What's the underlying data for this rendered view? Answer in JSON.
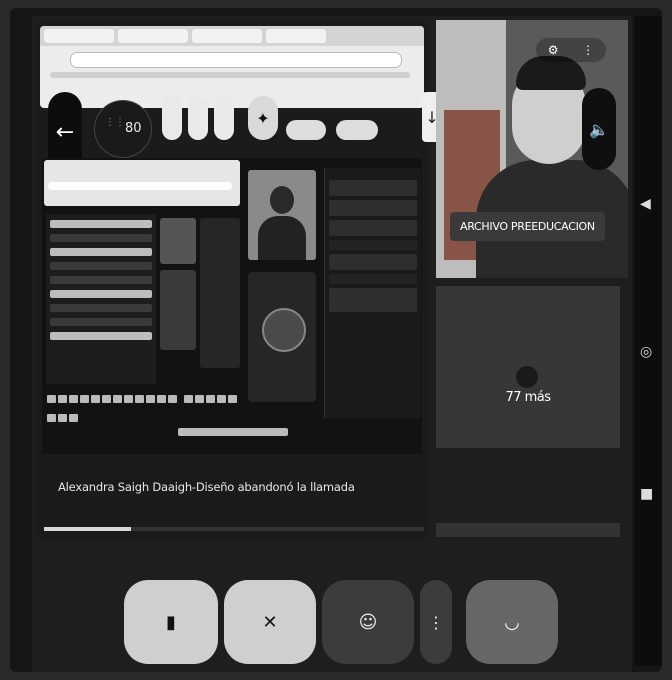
{
  "presentation": {
    "participants_count": "80",
    "notification": "Alexandra Saigh Daaigh-Diseño abandonó la llamada",
    "progress": 0.23
  },
  "camera_tile": {
    "name_label": "ARCHIVO PREEDUCACION"
  },
  "more_tile": {
    "label": "77 más"
  },
  "icons": {
    "back": "arrow-left-icon",
    "apps": "apps-grid-icon",
    "spark": "spark-icon",
    "download": "download-icon",
    "speaker": "speaker-icon",
    "camera_off": "camera-off-icon",
    "mic_off": "mic-off-icon",
    "emoji": "emoji-icon",
    "more": "more-vert-icon",
    "hangup": "hang-up-icon",
    "nav_back": "triangle-back-icon",
    "nav_home": "circle-home-icon",
    "nav_recent": "square-recent-icon"
  },
  "colors": {
    "background": "#1e1e1e",
    "light_button": "#cfcfcf",
    "dark_button": "#3c3c3c",
    "end_button": "#666666"
  }
}
